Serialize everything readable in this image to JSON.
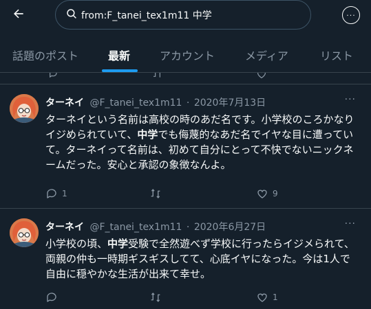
{
  "search": {
    "query": "from:F_tanei_tex1m11 中学"
  },
  "tabs": [
    {
      "label": "話題のポスト"
    },
    {
      "label": "最新"
    },
    {
      "label": "アカウント"
    },
    {
      "label": "メディア"
    },
    {
      "label": "リスト"
    }
  ],
  "active_tab": "最新",
  "tweets": [
    {
      "display_name": "ターネイ",
      "handle": "@F_tanei_tex1m11",
      "separator": "·",
      "date": "2020年7月13日",
      "text_a": "ターネイという名前は高校の時のあだ名です。小学校のころかなりイジめられていて、",
      "text_bold": "中学",
      "text_b": "でも侮蔑的なあだ名でイヤな目に遭っていて。ターネイって名前は、初めて自分にとって不快でないニックネームだった。安心と承認の象徴なんよ。",
      "replies": "1",
      "retweets": "",
      "likes": "9"
    },
    {
      "display_name": "ターネイ",
      "handle": "@F_tanei_tex1m11",
      "separator": "·",
      "date": "2020年6月27日",
      "text_a": "小学校の頃、",
      "text_bold": "中学",
      "text_b": "受験で全然遊べず学校に行ったらイジメられて、両親の仲も一時期ギスギスしてて、心底イヤになった。今は1人で自由に穏やかな生活が出来て幸せ。",
      "replies": "",
      "retweets": "",
      "likes": "1"
    }
  ],
  "colors": {
    "background": "#15202b",
    "text": "#f7f9f9",
    "muted": "#8b98a5",
    "accent": "#1d9bf0",
    "divider": "#38444d"
  }
}
